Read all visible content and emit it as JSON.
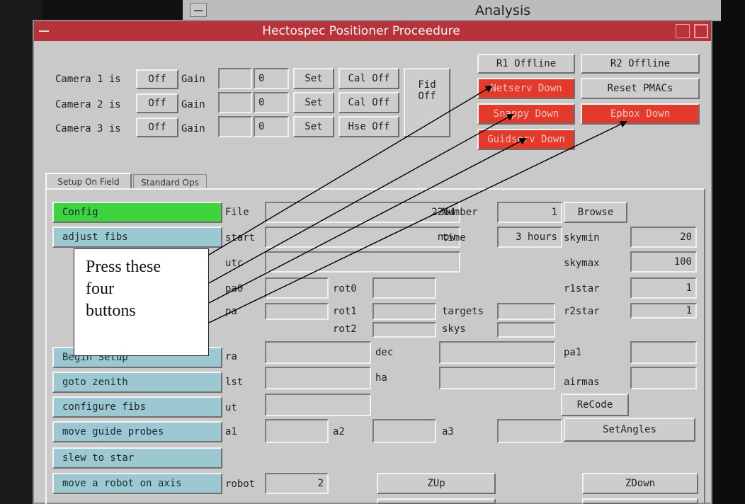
{
  "background_window": {
    "title": "Analysis"
  },
  "window": {
    "title": "Hectospec Positioner Proceedure"
  },
  "cameras": [
    {
      "label": "Camera 1 is",
      "state": "Off",
      "gain_label": "Gain",
      "gain_value": "0",
      "set": "Set",
      "cal": "Cal Off"
    },
    {
      "label": "Camera 2 is",
      "state": "Off",
      "gain_label": "Gain",
      "gain_value": "0",
      "set": "Set",
      "cal": "Cal Off"
    },
    {
      "label": "Camera 3 is",
      "state": "Off",
      "gain_label": "Gain",
      "gain_value": "0",
      "set": "Set",
      "cal": "Hse Off"
    }
  ],
  "fid_button": {
    "line1": "Fid",
    "line2": "Off"
  },
  "servers": {
    "r1": "R1 Offline",
    "r2": "R2 Offline",
    "netserv": "Netserv Down",
    "reset_pmacs": "Reset PMACs",
    "snappy": "Snappy Down",
    "epbox": "Epbox Down",
    "guidserv": "Guidserv Down"
  },
  "tabs": [
    "Setup On Field",
    "Standard Ops"
  ],
  "actions": {
    "config": "Config",
    "adjust_fibs": "adjust fibs",
    "hidden": "Begin Setup",
    "goto_zenith": "goto zenith",
    "configure_fibs": "configure fibs",
    "move_guide_probes": "move guide probes",
    "slew_to_star": "slew to star",
    "move_robot": "move a robot on axis"
  },
  "fields": {
    "file_label": "File",
    "file_value": "2264",
    "number_label": "Number",
    "number_value": "1",
    "browse": "Browse",
    "start_label": "start",
    "start_value": "now",
    "time_label": "time",
    "time_value": "3 hours",
    "skymin_label": "skymin",
    "skymin_value": "20",
    "utc_label": "utc",
    "skymax_label": "skymax",
    "skymax_value": "100",
    "pa0_label": "pa0",
    "rot0_label": "rot0",
    "r1star_label": "r1star",
    "r1star_value": "1",
    "pa_label": "pa",
    "rot1_label": "rot1",
    "targets_label": "targets",
    "r2star_label": "r2star",
    "r2star_value": "1",
    "rot2_label": "rot2",
    "skys_label": "skys",
    "ra_label": "ra",
    "dec_label": "dec",
    "pa1_label": "pa1",
    "lst_label": "lst",
    "ha_label": "ha",
    "airmas_label": "airmas",
    "ut_label": "ut",
    "recode": "ReCode",
    "a1_label": "a1",
    "a2_label": "a2",
    "a3_label": "a3",
    "setangles": "SetAngles",
    "robot_label": "robot",
    "robot_value": "2",
    "zup": "ZUp",
    "zdown": "ZDown"
  },
  "callout": {
    "line1": "Press these",
    "line2": "four",
    "line3": "buttons"
  },
  "colors": {
    "titlebar": "#b8323a",
    "down": "#e43a2c",
    "config": "#3ed43e",
    "action": "#9cc9d1",
    "window": "#c9c9c9"
  }
}
